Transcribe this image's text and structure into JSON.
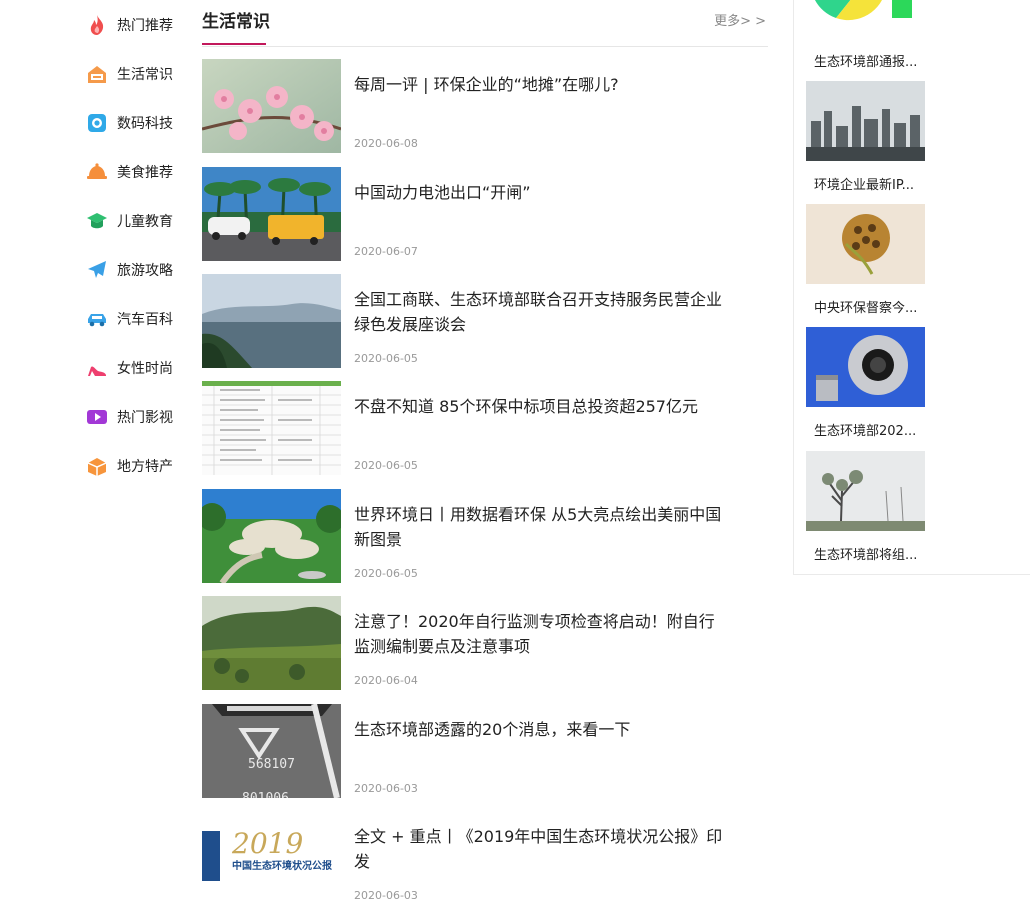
{
  "nav": {
    "items": [
      {
        "label": "热门推荐",
        "icon": "flame-icon"
      },
      {
        "label": "生活常识",
        "icon": "house-icon"
      },
      {
        "label": "数码科技",
        "icon": "camera-icon"
      },
      {
        "label": "美食推荐",
        "icon": "food-cloche-icon"
      },
      {
        "label": "儿童教育",
        "icon": "graduation-cap-icon"
      },
      {
        "label": "旅游攻略",
        "icon": "airplane-icon"
      },
      {
        "label": "汽车百科",
        "icon": "car-icon"
      },
      {
        "label": "女性时尚",
        "icon": "high-heel-icon"
      },
      {
        "label": "热门影视",
        "icon": "video-play-icon"
      },
      {
        "label": "地方特产",
        "icon": "gift-box-icon"
      }
    ]
  },
  "section": {
    "title": "生活常识",
    "more": "更多> >",
    "accent": "#c2185b"
  },
  "articles": [
    {
      "title": "每周一评 | 环保企业的“地摊”在哪儿?",
      "date": "2020-06-08"
    },
    {
      "title": "中国动力电池出口“开闸”",
      "date": "2020-06-07"
    },
    {
      "title": "全国工商联、生态环境部联合召开支持服务民营企业绿色发展座谈会",
      "date": "2020-06-05"
    },
    {
      "title": "不盘不知道 85个环保中标项目总投资超257亿元",
      "date": "2020-06-05"
    },
    {
      "title": "世界环境日丨用数据看环保 从5大亮点绘出美丽中国新图景",
      "date": "2020-06-05"
    },
    {
      "title": "注意了！2020年自行监测专项检查将启动！附自行监测编制要点及注意事项",
      "date": "2020-06-04"
    },
    {
      "title": "生态环境部透露的20个消息，来看一下",
      "date": "2020-06-03"
    },
    {
      "title": "全文 + 重点丨《2019年中国生态环境状况公报》印发",
      "date": "2020-06-03"
    }
  ],
  "thumb_text": {
    "plate": "568107",
    "plate2": "801006",
    "report_year": "2019",
    "report_name": "中国生态环境状况公报"
  },
  "sidebar": {
    "items": [
      {
        "caption": "生态环境部通报..."
      },
      {
        "caption": "环境企业最新IP..."
      },
      {
        "caption": "中央环保督察今..."
      },
      {
        "caption": "生态环境部202..."
      },
      {
        "caption": "生态环境部将组..."
      }
    ]
  }
}
